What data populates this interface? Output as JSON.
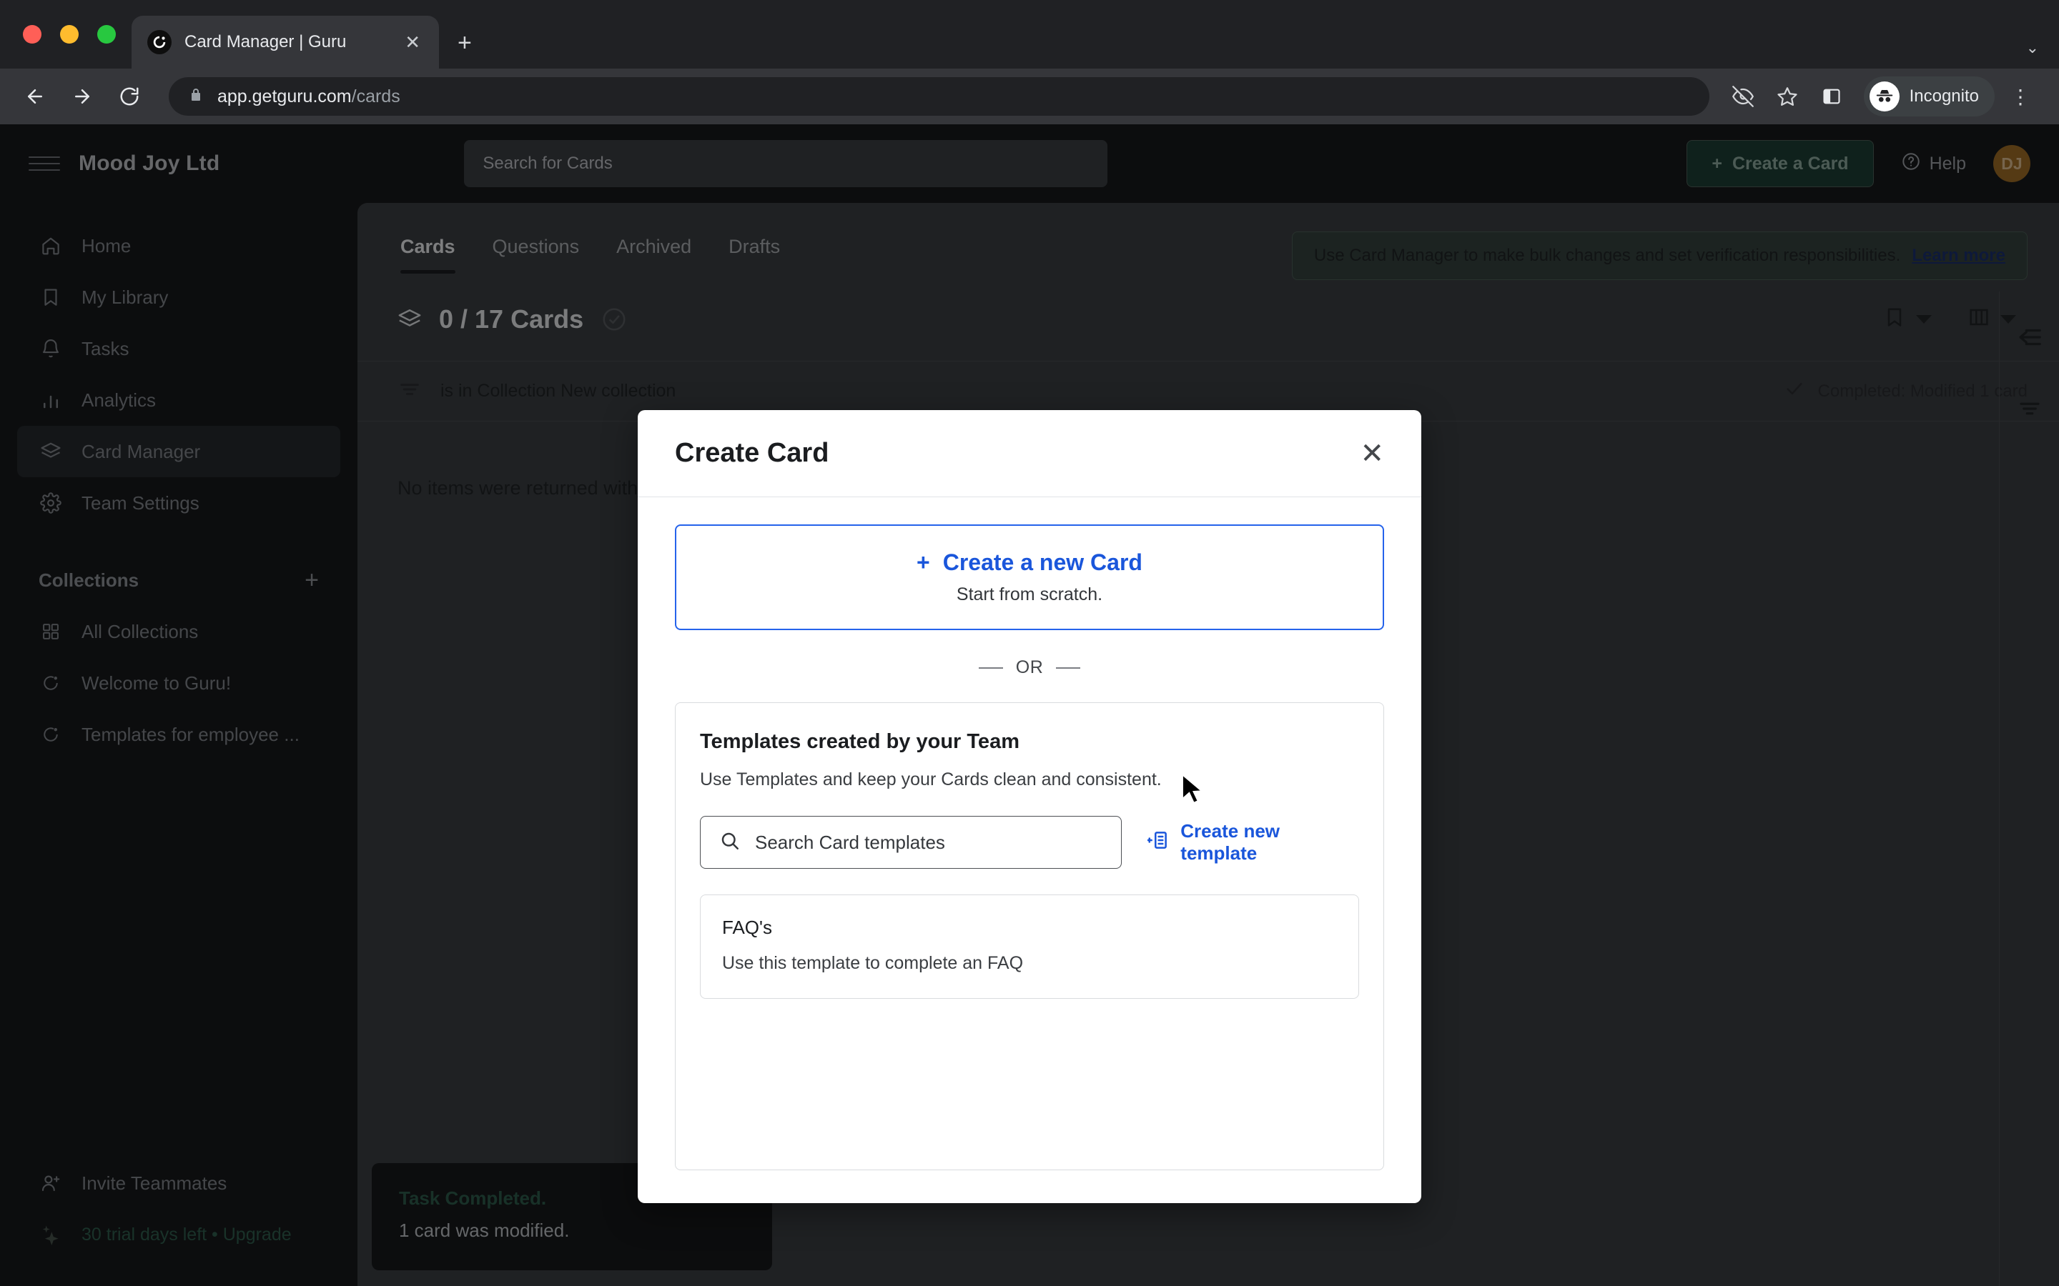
{
  "browser": {
    "tab": {
      "title": "Card Manager | Guru",
      "favicon": "guru-icon",
      "close": "✕"
    },
    "new_tab_label": "+",
    "tabstrip_menu": "⌄",
    "back": "←",
    "forward": "→",
    "reload": "⟳",
    "url_host": "app.getguru.com",
    "url_path": "/cards",
    "lock_icon": "lock-icon",
    "icons": {
      "eye_off": "eye-off-icon",
      "bookmark_star": "star-icon",
      "side_panel": "side-panel-icon"
    },
    "profile_label": "Incognito",
    "menu": "⋮"
  },
  "header": {
    "brand": "Mood Joy Ltd",
    "search_placeholder": "Search for Cards",
    "create_card_label": "Create a Card",
    "help_label": "Help",
    "avatar_initials": "DJ"
  },
  "sidebar": {
    "items": [
      {
        "label": "Home",
        "icon": "home-icon"
      },
      {
        "label": "My Library",
        "icon": "bookmark-icon"
      },
      {
        "label": "Tasks",
        "icon": "bell-icon"
      },
      {
        "label": "Analytics",
        "icon": "bar-chart-icon"
      },
      {
        "label": "Card Manager",
        "icon": "layers-icon"
      },
      {
        "label": "Team Settings",
        "icon": "gear-icon"
      }
    ],
    "collections_title": "Collections",
    "collections_add": "+",
    "collections": [
      {
        "label": "All Collections",
        "icon": "grid-icon"
      },
      {
        "label": "Welcome to Guru!",
        "icon": "guru-icon"
      },
      {
        "label": "Templates for employee ...",
        "icon": "guru-icon"
      }
    ],
    "footer": {
      "invite_label": "Invite Teammates",
      "trial_label": "30 trial days left • Upgrade"
    }
  },
  "main": {
    "tabs": [
      {
        "label": "Cards",
        "active": true
      },
      {
        "label": "Questions",
        "active": false
      },
      {
        "label": "Archived",
        "active": false
      },
      {
        "label": "Drafts",
        "active": false
      }
    ],
    "banner_text": "Use Card Manager to make bulk changes and set verification responsibilities.",
    "banner_link": "Learn more",
    "card_count": "0 / 17 Cards",
    "filter_text": "is in Collection New collection",
    "status_text": "Completed: Modified 1 card",
    "empty_state": "No items were returned with this filter.",
    "rail_icons": [
      "collapse-panel-icon",
      "filter-icon"
    ]
  },
  "toast": {
    "title": "Task Completed.",
    "body": "1 card was modified.",
    "close": "✕"
  },
  "modal": {
    "title": "Create Card",
    "close": "✕",
    "new_card": {
      "plus": "+",
      "title": "Create a new Card",
      "subtitle": "Start from scratch."
    },
    "or_label": "OR",
    "templates": {
      "title": "Templates created by your Team",
      "subtitle": "Use Templates and keep your Cards clean and consistent.",
      "search_placeholder": "Search Card templates",
      "create_link": "Create new template",
      "items": [
        {
          "title": "FAQ's",
          "description": "Use this template to complete an FAQ"
        }
      ]
    }
  },
  "colors": {
    "accent_blue": "#1a56db",
    "brand_green": "#1d3c33",
    "toast_green": "#2c5a4a",
    "avatar_orange": "#9c6a26"
  }
}
